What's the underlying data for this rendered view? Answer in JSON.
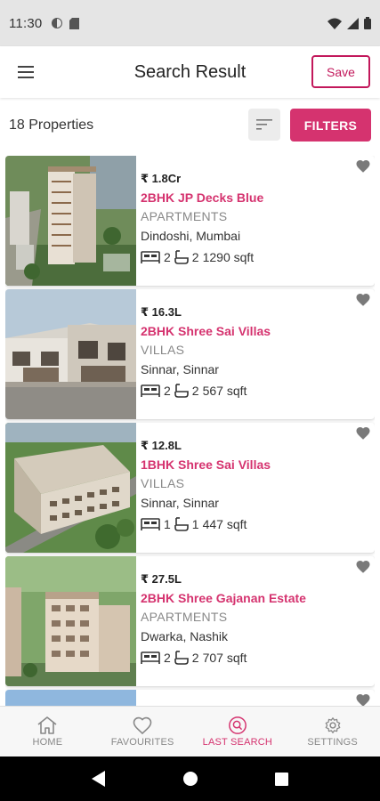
{
  "status_bar": {
    "time": "11:30"
  },
  "app_bar": {
    "title": "Search Result",
    "save_label": "Save"
  },
  "toolbar": {
    "count_label": "18 Properties",
    "filters_label": "FILTERS"
  },
  "listings": [
    {
      "price": "₹ 1.8Cr",
      "name": "2BHK JP Decks Blue",
      "type": "APARTMENTS",
      "location": "Dindoshi, Mumbai",
      "beds": "2",
      "baths": "2",
      "area": "1290 sqft"
    },
    {
      "price": "₹ 16.3L",
      "name": "2BHK Shree Sai Villas",
      "type": "VILLAS",
      "location": "Sinnar, Sinnar",
      "beds": "2",
      "baths": "2",
      "area": "567 sqft"
    },
    {
      "price": "₹ 12.8L",
      "name": "1BHK Shree Sai Villas",
      "type": "VILLAS",
      "location": "Sinnar, Sinnar",
      "beds": "1",
      "baths": "1",
      "area": "447 sqft"
    },
    {
      "price": "₹ 27.5L",
      "name": "2BHK Shree Gajanan Estate",
      "type": "APARTMENTS",
      "location": "Dwarka, Nashik",
      "beds": "2",
      "baths": "2",
      "area": "707 sqft"
    }
  ],
  "bottom_nav": [
    {
      "label": "HOME",
      "icon": "home-icon",
      "active": false
    },
    {
      "label": "FAVOURITES",
      "icon": "heart-icon",
      "active": false
    },
    {
      "label": "LAST SEARCH",
      "icon": "search-circle-icon",
      "active": true
    },
    {
      "label": "SETTINGS",
      "icon": "gear-icon",
      "active": false
    }
  ],
  "colors": {
    "accent": "#d5336f",
    "save_border": "#c2185b",
    "status_bar": "#e5e5e5",
    "nav_bg": "#f7f7f7"
  }
}
